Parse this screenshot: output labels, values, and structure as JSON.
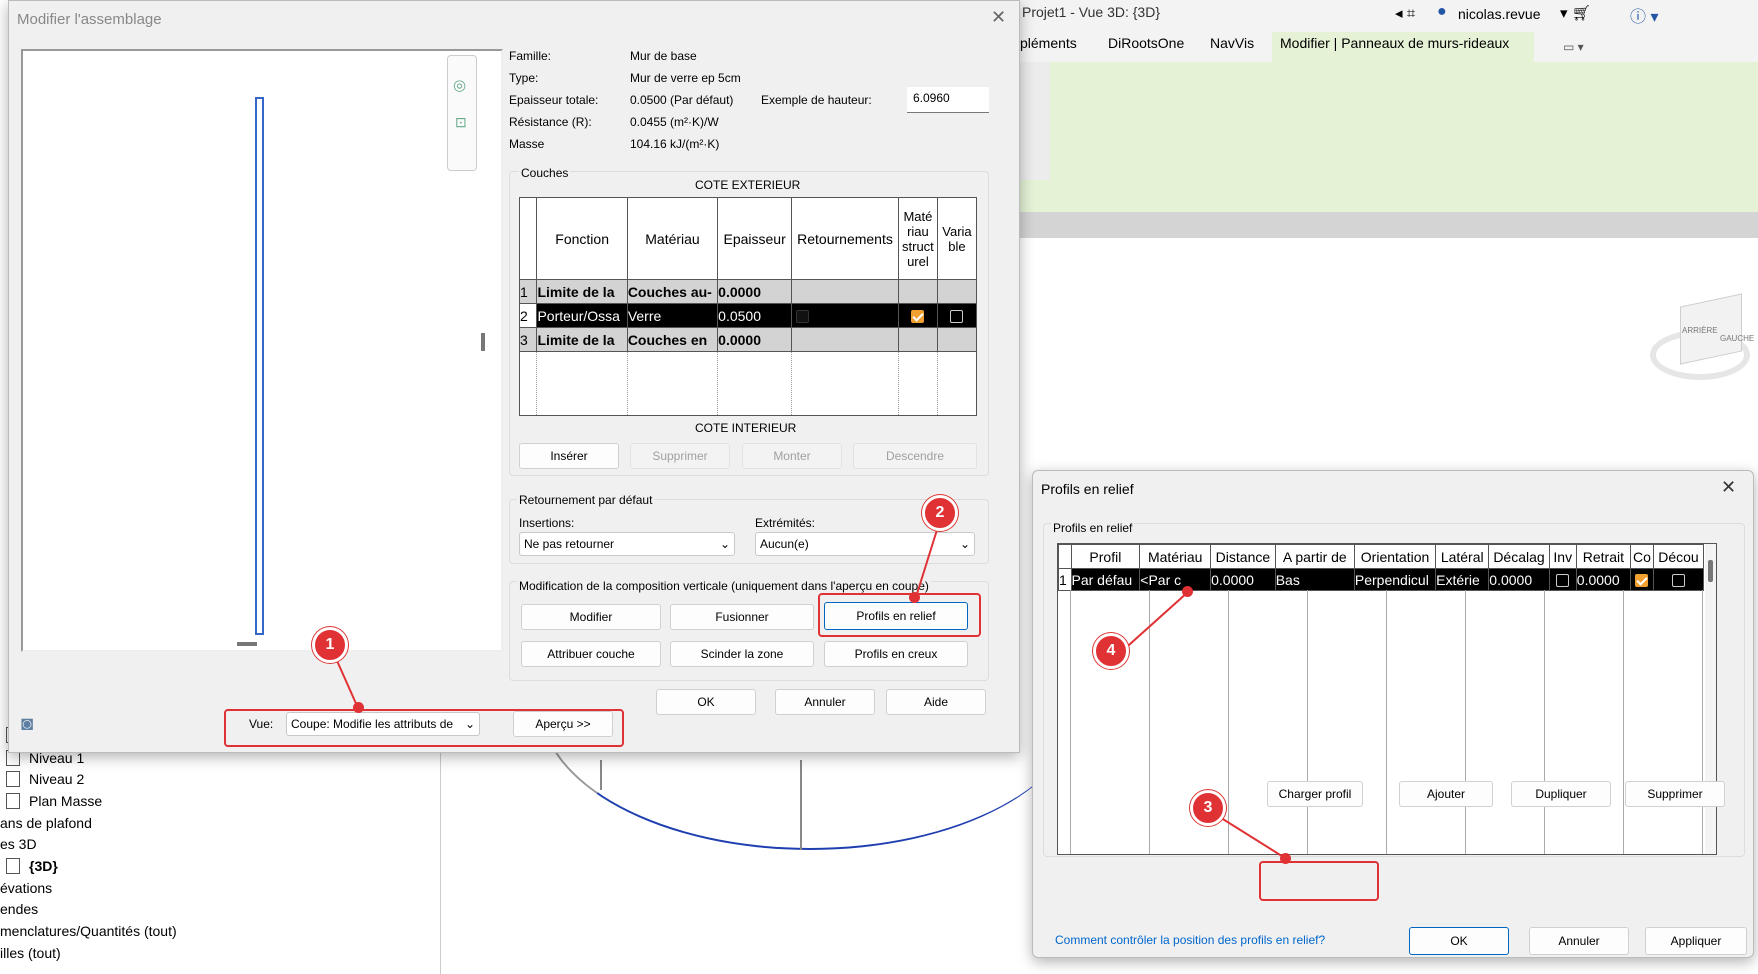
{
  "app": {
    "title": "Projet1 - Vue 3D: {3D}",
    "user": "nicolas.revue",
    "tabs": [
      "pléments",
      "DiRootsOne",
      "NavVis",
      "Modifier | Panneaux de murs-rideaux"
    ]
  },
  "tree": {
    "items": [
      "Niveau 1",
      "Niveau 2",
      "Plan Masse",
      "ans de plafond",
      "es 3D",
      "{3D}",
      "évations",
      "endes",
      "menclatures/Quantités (tout)",
      "illes (tout)"
    ]
  },
  "assemblage": {
    "title": "Modifier l'assemblage",
    "props": {
      "famille_label": "Famille:",
      "famille": "Mur de base",
      "type_label": "Type:",
      "type": "Mur de verre ep 5cm",
      "epaisseur_label": "Epaisseur totale:",
      "epaisseur": "0.0500 (Par défaut)",
      "hauteur_label": "Exemple de hauteur:",
      "hauteur": "6.0960",
      "resistance_label": "Résistance (R):",
      "resistance": "0.0455 (m²·K)/W",
      "masse_label": "Masse",
      "masse": "104.16 kJ/(m²·K)"
    },
    "couches_label": "Couches",
    "cote_ext": "COTE EXTERIEUR",
    "cote_int": "COTE INTERIEUR",
    "columns": [
      "Fonction",
      "Matériau",
      "Epaisseur",
      "Retournements",
      "Maté riau struct urel",
      "Varia ble"
    ],
    "rows": [
      {
        "n": "1",
        "fonction": "Limite de la",
        "materiau": "Couches au-",
        "epaisseur": "0.0000"
      },
      {
        "n": "2",
        "fonction": "Porteur/Ossa",
        "materiau": "Verre",
        "epaisseur": "0.0500"
      },
      {
        "n": "3",
        "fonction": "Limite de la",
        "materiau": "Couches en",
        "epaisseur": "0.0000"
      }
    ],
    "layer_buttons": [
      "Insérer",
      "Supprimer",
      "Monter",
      "Descendre"
    ],
    "retournement_label": "Retournement par défaut",
    "insertions_label": "Insertions:",
    "insertions": "Ne pas retourner",
    "extremites_label": "Extrémités:",
    "extremites": "Aucun(e)",
    "modif_label": "Modification de la composition verticale (uniquement dans l'aperçu en coupe)",
    "modif_buttons": [
      "Modifier",
      "Fusionner",
      "Profils en relief",
      "Attribuer couche",
      "Scinder la zone",
      "Profils en creux"
    ],
    "ok": "OK",
    "annuler": "Annuler",
    "aide": "Aide",
    "vue_label": "Vue:",
    "vue": "Coupe: Modifie les attributs de",
    "apercu": "Aperçu >>"
  },
  "profils": {
    "title": "Profils en relief",
    "group": "Profils en relief",
    "columns": [
      "Profil",
      "Matériau",
      "Distance",
      "A partir de",
      "Orientation",
      "Latéral",
      "Décalag",
      "Inv",
      "Retrait",
      "Co",
      "Décou"
    ],
    "row": {
      "n": "1",
      "profil": "Par défau",
      "materiau": "<Par c",
      "distance": "0.0000",
      "apartir": "Bas",
      "orientation": "Perpendicul",
      "lateral": "Extérie",
      "decalage": "0.0000",
      "retrait": "0.0000"
    },
    "buttons": [
      "Charger profil",
      "Ajouter",
      "Dupliquer",
      "Supprimer"
    ],
    "link": "Comment contrôler la position des profils en relief?",
    "ok": "OK",
    "annuler": "Annuler",
    "appliquer": "Appliquer"
  },
  "badges": [
    "1",
    "2",
    "3",
    "4"
  ],
  "viewcube": {
    "face1": "ARRIÈRE",
    "face2": "GAUCHE"
  }
}
